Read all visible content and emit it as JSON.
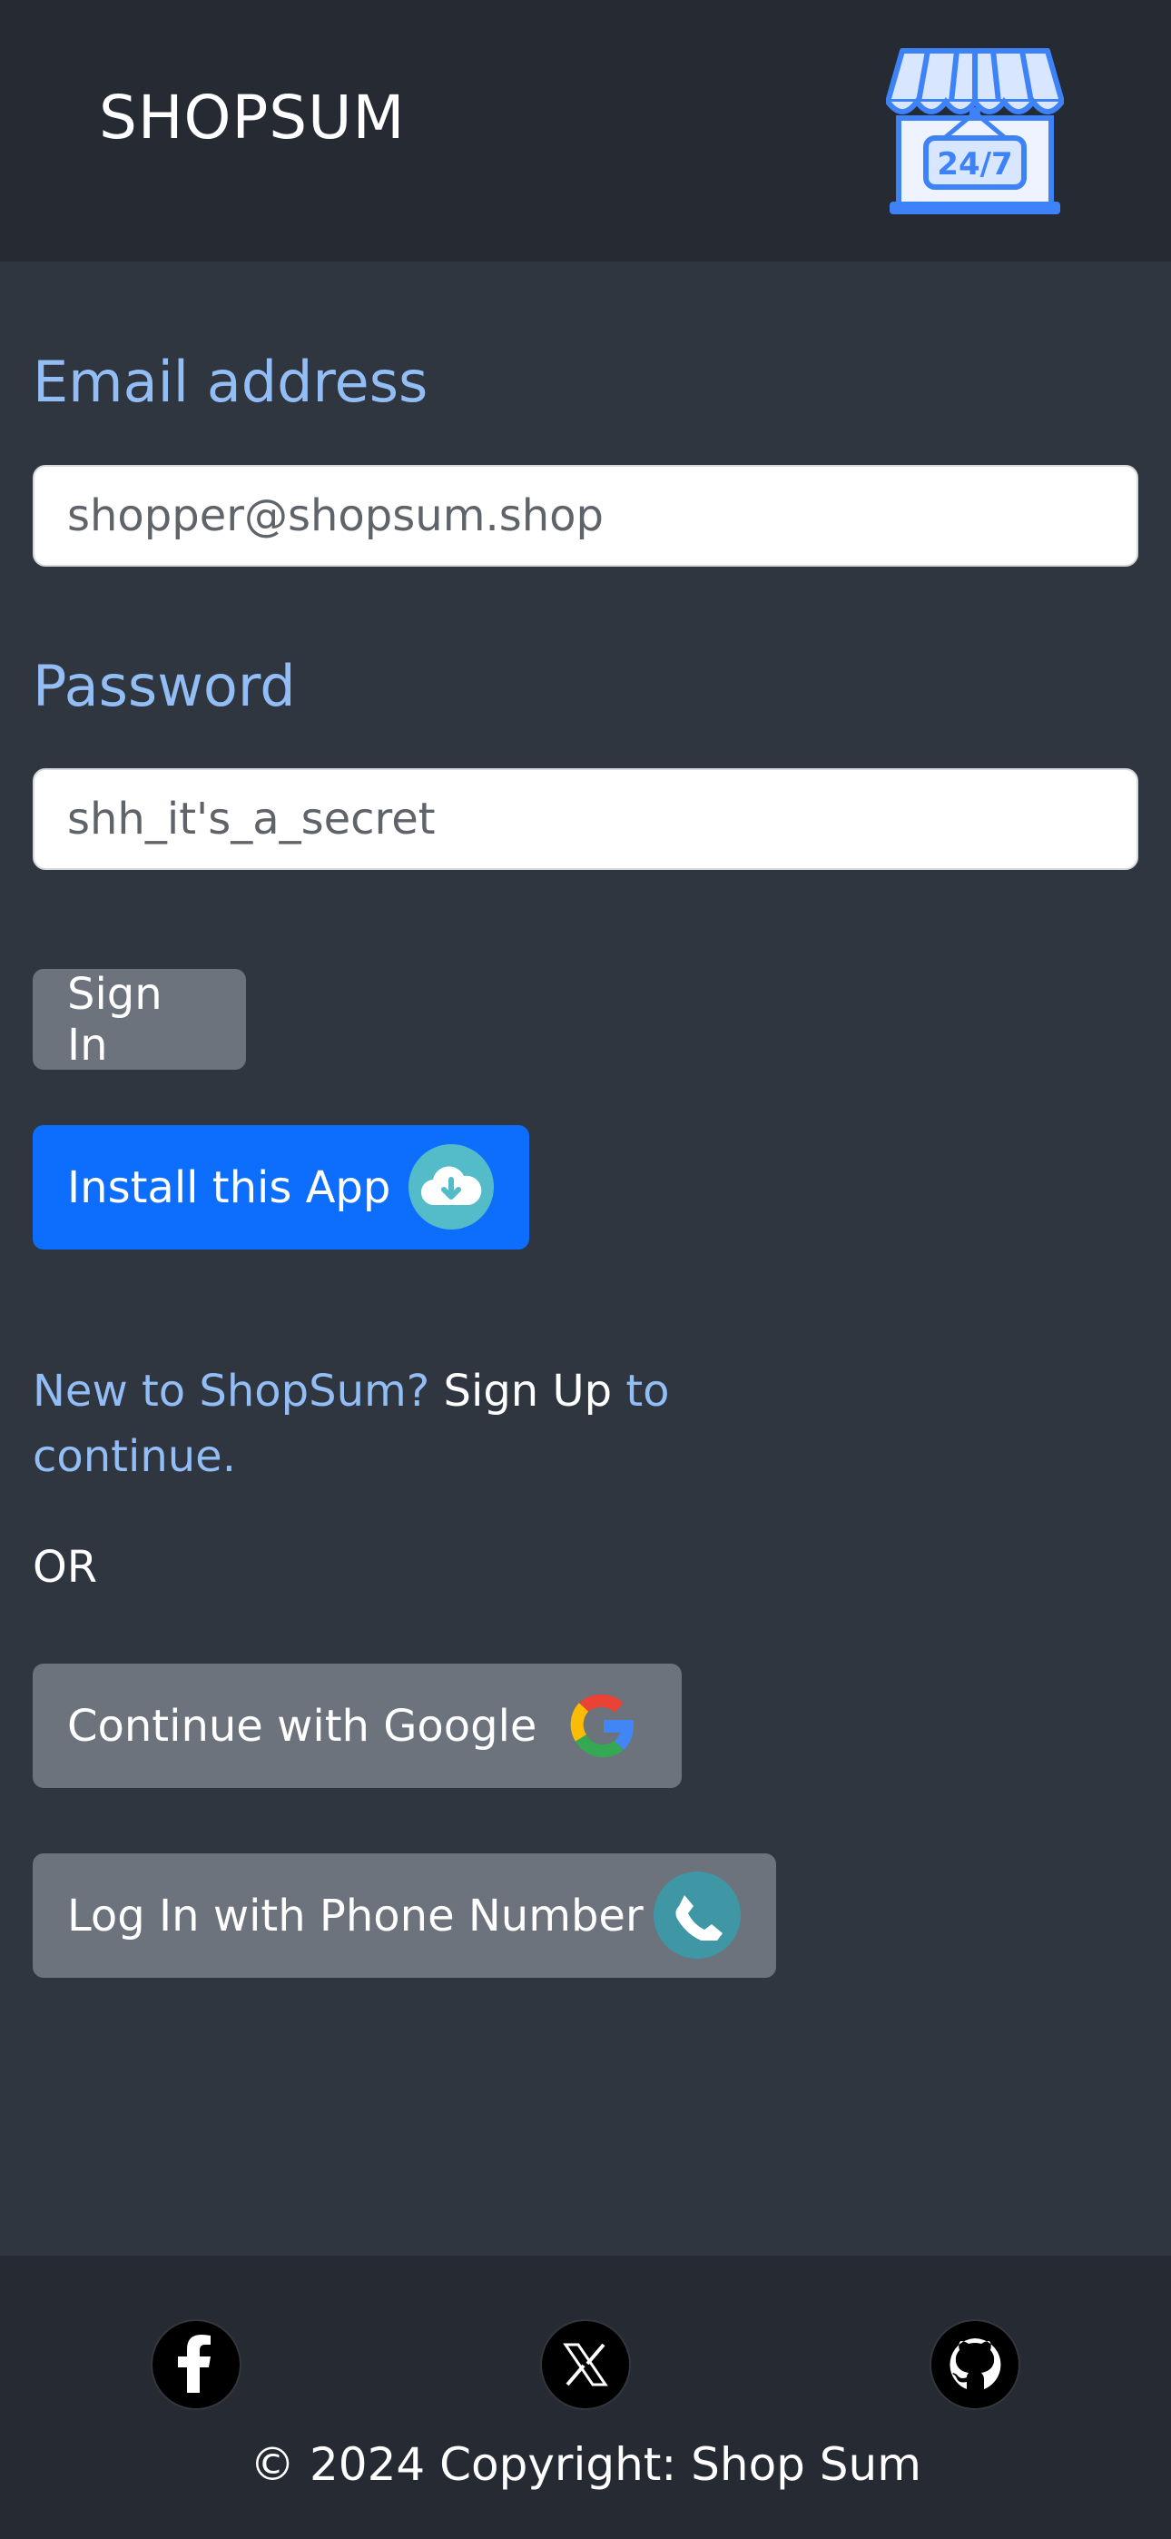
{
  "header": {
    "brand": "SHOPSUM",
    "logo_icon": "storefront-24-7-icon",
    "logo_text": "24/7"
  },
  "form": {
    "email_label": "Email address",
    "email_placeholder": "shopper@shopsum.shop",
    "password_label": "Password",
    "password_placeholder": "shh_it's_a_secret",
    "signin_label": "Sign In"
  },
  "install": {
    "label": "Install this App",
    "icon": "cloud-download-icon"
  },
  "signup": {
    "prefix": "New to ShopSum?",
    "link": "Sign Up",
    "suffix": "to continue."
  },
  "divider_text": "OR",
  "social_login": {
    "google_label": "Continue with Google",
    "google_icon": "google-icon",
    "phone_label": "Log In with Phone Number",
    "phone_icon": "phone-icon"
  },
  "footer": {
    "social_icons": [
      "facebook-icon",
      "x-icon",
      "github-icon"
    ],
    "copyright": "© 2024 Copyright: Shop Sum"
  },
  "colors": {
    "header_bg": "#262a32",
    "page_bg": "#303640",
    "label_blue": "#93bdf5",
    "primary_button": "#0d6efd",
    "secondary_button": "#6c737c"
  }
}
